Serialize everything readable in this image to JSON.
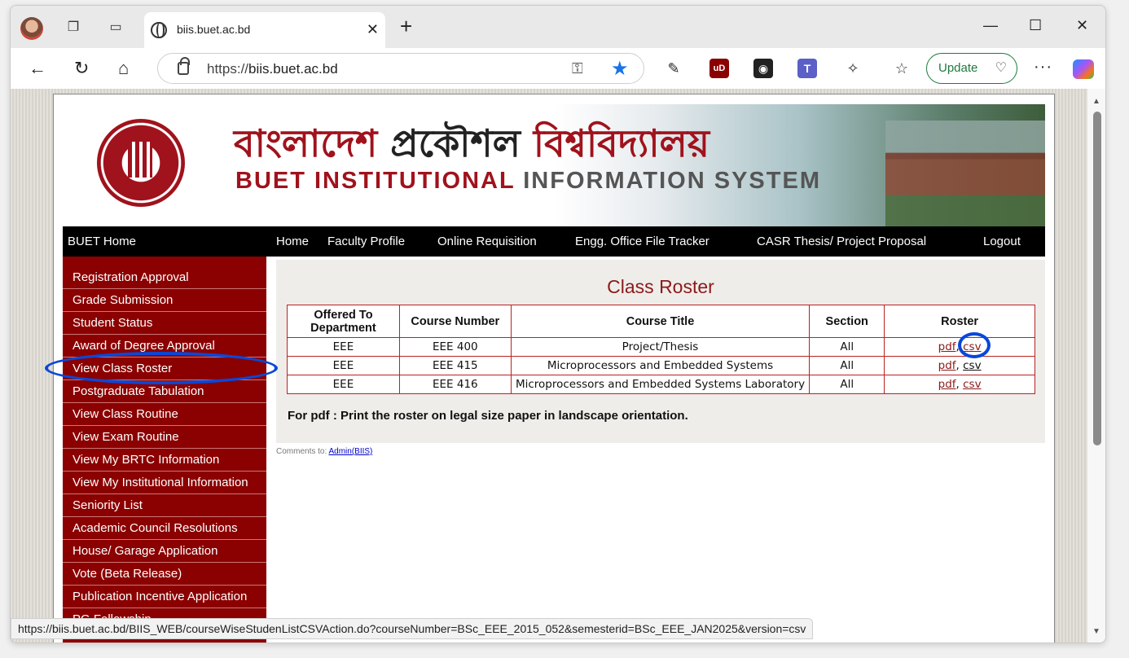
{
  "browser": {
    "tab_title": "biis.buet.ac.bd",
    "url_scheme": "https://",
    "url_host": "biis.buet.ac.bd",
    "update_label": "Update",
    "status_url": "https://biis.buet.ac.bd/BIIS_WEB/courseWiseStudenListCSVAction.do?courseNumber=BSc_EEE_2015_052&semesterid=BSc_EEE_JAN2025&version=csv"
  },
  "banner": {
    "bangla_red": "বাংলাদেশ",
    "bangla_black": "প্রকৌশল",
    "bangla_red2": "বিশ্ববিদ্যালয়",
    "english_red": "BUET INSTITUTIONAL",
    "english_grey": "INFORMATION SYSTEM"
  },
  "topnav": {
    "buet_home": "BUET Home",
    "home": "Home",
    "faculty_profile": "Faculty Profile",
    "online_requisition": "Online Requisition",
    "file_tracker": "Engg. Office File Tracker",
    "casr": "CASR Thesis/ Project Proposal",
    "logout": "Logout"
  },
  "sidebar": {
    "items": [
      "Registration Approval",
      "Grade Submission",
      "Student Status",
      "Award of Degree Approval",
      "View Class Roster",
      "Postgraduate Tabulation",
      "View Class Routine",
      "View Exam Routine",
      "View My BRTC Information",
      "View My Institutional Information",
      "Seniority List",
      "Academic Council Resolutions",
      "House/ Garage Application",
      "Vote (Beta Release)",
      "Publication Incentive Application",
      "PG Fellowship"
    ]
  },
  "roster": {
    "title": "Class Roster",
    "headers": [
      "Offered To Department",
      "Course Number",
      "Course Title",
      "Section",
      "Roster"
    ],
    "rows": [
      {
        "dept": "EEE",
        "number": "EEE 400",
        "title": "Project/Thesis",
        "section": "All"
      },
      {
        "dept": "EEE",
        "number": "EEE 415",
        "title": "Microprocessors and Embedded Systems",
        "section": "All"
      },
      {
        "dept": "EEE",
        "number": "EEE 416",
        "title": "Microprocessors and Embedded Systems Laboratory",
        "section": "All"
      }
    ],
    "pdf_label": "pdf",
    "csv_label": "csv",
    "note_bold": "For pdf :",
    "note_text": " Print the roster on legal size paper in landscape orientation."
  },
  "footer": {
    "comments_label": "Comments to: ",
    "admin_link": "Admin(BIIS)"
  },
  "colors": {
    "brand_red": "#8b0000",
    "annotation_blue": "#0a47d8"
  }
}
